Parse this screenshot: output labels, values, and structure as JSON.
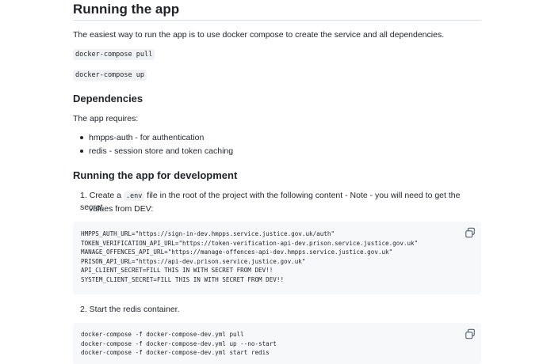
{
  "heading": "Running the app",
  "intro": "The easiest way to run the app is to use docker compose to create the service and all dependencies.",
  "cmd_pull": "docker-compose pull",
  "cmd_up": "docker-compose up",
  "dependencies": {
    "heading": "Dependencies",
    "intro": "The app requires:",
    "items": [
      "hmpps-auth - for authentication",
      "redis - session store and token caching"
    ]
  },
  "development": {
    "heading": "Running the app for development",
    "step1": {
      "number": "1.",
      "before": "Create a",
      "code": ".env",
      "after": "file in the root of the project with the following content - Note - you will need to get the secret",
      "continuation": "values from DEV:"
    },
    "env_lines": [
      "HMPPS_AUTH_URL=\"https://sign-in-dev.hmpps.service.justice.gov.uk/auth\"",
      "TOKEN_VERIFICATION_API_URL=\"https://token-verification-api-dev.prison.service.justice.gov.uk\"",
      "MANAGE_OFFENCES_API_URL=\"https://manage-offences-api-dev.hmpps.service.justice.gov.uk\"",
      "PRISON_API_URL=\"https://api-dev.prison.service.justice.gov.uk\"",
      "API_CLIENT_SECRET=FILL THIS IN WITH SECRET FROM DEV!!",
      "SYSTEM_CLIENT_SECRET=FILL THIS IN WITH SECRET FROM DEV!!"
    ],
    "step2": "2. Start the redis container.",
    "redis_lines": [
      "docker-compose -f docker-compose-dev.yml pull",
      "docker-compose -f docker-compose-dev.yml up --no-start",
      "docker-compose -f docker-compose-dev.yml start redis"
    ]
  },
  "icons": {
    "copy": "copy-icon"
  }
}
